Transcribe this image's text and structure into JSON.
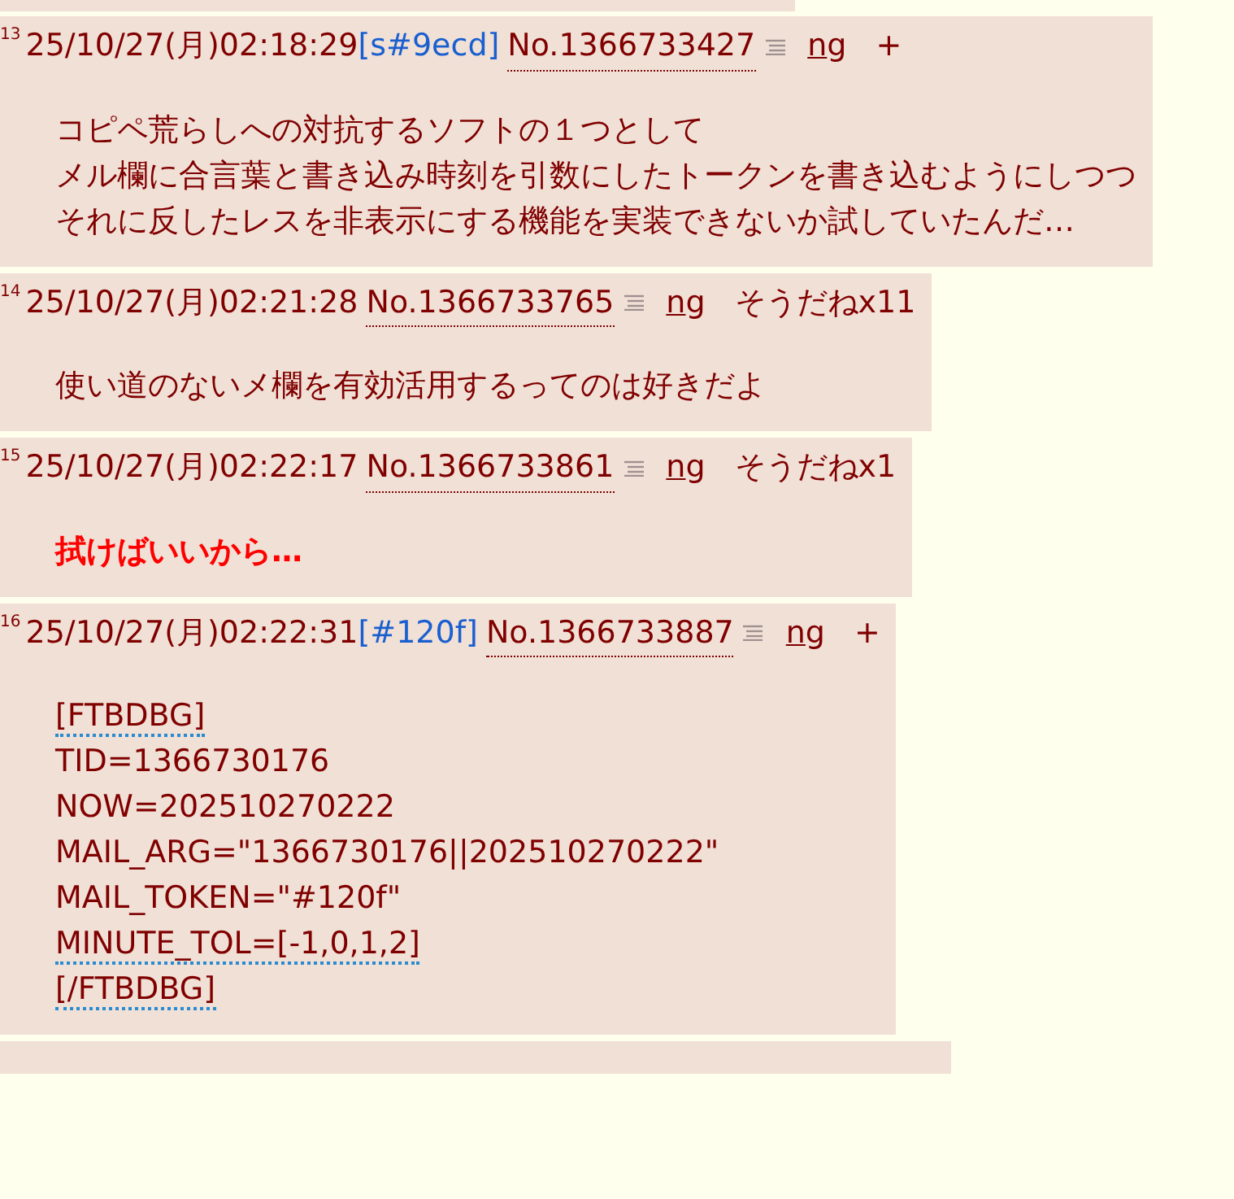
{
  "posts": [
    {
      "number": "13",
      "date": "25/10/27(月)02:18:29",
      "id": "[s#9ecd]",
      "no": "No.1366733427",
      "ng": "ng",
      "sodane": "+",
      "emphasized": false,
      "lines": [
        {
          "text": "コピペ荒らしへの対抗するソフトの１つとして",
          "underlined": false
        },
        {
          "text": "メル欄に合言葉と書き込み時刻を引数にしたトークンを書き込むようにしつつ",
          "underlined": false
        },
        {
          "text": "それに反したレスを非表示にする機能を実装できないか試していたんだ…",
          "underlined": false
        }
      ]
    },
    {
      "number": "14",
      "date": "25/10/27(月)02:21:28",
      "no": "No.1366733765",
      "ng": "ng",
      "sodane": "そうだねx11",
      "emphasized": false,
      "lines": [
        {
          "text": "使い道のないメ欄を有効活用するってのは好きだよ",
          "underlined": false
        }
      ]
    },
    {
      "number": "15",
      "date": "25/10/27(月)02:22:17",
      "no": "No.1366733861",
      "ng": "ng",
      "sodane": "そうだねx1",
      "emphasized": true,
      "lines": [
        {
          "text": "拭けばいいから…",
          "underlined": false
        }
      ]
    },
    {
      "number": "16",
      "date": "25/10/27(月)02:22:31",
      "id": "[#120f]",
      "no": "No.1366733887",
      "ng": "ng",
      "sodane": "+",
      "emphasized": false,
      "lines": [
        {
          "text": "[FTBDBG]",
          "underlined": true
        },
        {
          "text": "TID=1366730176",
          "underlined": false
        },
        {
          "text": "NOW=202510270222",
          "underlined": false
        },
        {
          "text": "MAIL_ARG=\"1366730176||202510270222\"",
          "underlined": false
        },
        {
          "text": "MAIL_TOKEN=\"#120f\"",
          "underlined": false
        },
        {
          "text": "MINUTE_TOL=[-1,0,1,2]",
          "underlined": true
        },
        {
          "text": "[/FTBDBG]",
          "underlined": true
        }
      ]
    }
  ]
}
